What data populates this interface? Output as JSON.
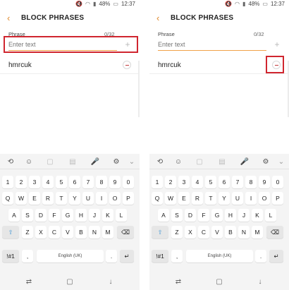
{
  "statusbar": {
    "battery_pct": "48%",
    "time": "12:37"
  },
  "header": {
    "title": "BLOCK PHRASES"
  },
  "form": {
    "phrase_label": "Phrase",
    "counter": "0/32",
    "input_placeholder": "Enter text",
    "input_value": ""
  },
  "phrases": [
    {
      "text": "hmrcuk"
    }
  ],
  "keyboard": {
    "row_numbers": [
      "1",
      "2",
      "3",
      "4",
      "5",
      "6",
      "7",
      "8",
      "9",
      "0"
    ],
    "row_q": [
      "Q",
      "W",
      "E",
      "R",
      "T",
      "Y",
      "U",
      "I",
      "O",
      "P"
    ],
    "row_a": [
      "A",
      "S",
      "D",
      "F",
      "G",
      "H",
      "J",
      "K",
      "L"
    ],
    "row_z": [
      "Z",
      "X",
      "C",
      "V",
      "B",
      "N",
      "M"
    ],
    "sym_label": "!#1",
    "comma": ",",
    "space_label": "English (UK)",
    "period": ".",
    "shift_glyph": "⇧",
    "backspace_glyph": "⌫",
    "enter_glyph": "↵"
  },
  "icons": {
    "back": "‹",
    "add": "+",
    "mute": "🔇",
    "wifi": "◠",
    "signal": "▮",
    "battery": "▭",
    "translate": "⟲",
    "emoji": "☺",
    "sticker": "▢",
    "note": "▤",
    "mic": "🎤",
    "settings": "⚙",
    "chevron": "⌄",
    "nav_recent": "⇄",
    "nav_home": "▢",
    "nav_back": "↓"
  }
}
